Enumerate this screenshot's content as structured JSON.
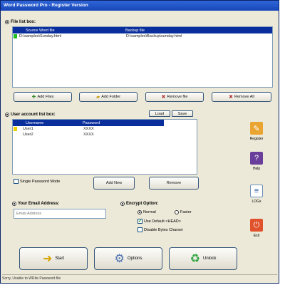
{
  "window": {
    "title": "Word Password Pro - Register Version"
  },
  "file_list": {
    "label": "File list box:",
    "columns": [
      "Source Word file",
      "Backup file"
    ],
    "rows": [
      {
        "source": "D:\\samples\\Sunday.html",
        "backup": "D:\\samples\\Backup\\sunday.html",
        "mark_color": "#1fbf1f"
      }
    ],
    "buttons": {
      "add_files": "Add Files",
      "add_folder": "Add Folder",
      "remove_file": "Remove file",
      "remove_all": "Remove All"
    }
  },
  "user_list": {
    "label": "User account list box:",
    "load_label": "Load",
    "save_label": "Save",
    "columns": [
      "Username",
      "Password"
    ],
    "rows": [
      {
        "username": "User1",
        "password": "XXXX",
        "mark_color": "#f0d000"
      },
      {
        "username": "User2",
        "password": "XXXX",
        "mark_color": ""
      }
    ],
    "single_password_mode": "Single Password Mode",
    "add_new": "Add New",
    "remove": "Remove"
  },
  "email": {
    "label": "Your Email Address:",
    "placeholder": "Email Address"
  },
  "encrypt": {
    "label": "Encrypt Option:",
    "normal": "Normal",
    "faster": "Faster",
    "use_default": "Use Default <HEAD>",
    "disable_charset": "Disable Bytes Charset"
  },
  "side": {
    "register": "Register",
    "help": "Help",
    "logs": "LOGs",
    "exit": "Exit"
  },
  "actions": {
    "start": "Start",
    "options": "Options",
    "unlock": "Unlock"
  },
  "status": "Sorry, Unable to WRIte Password file",
  "colors": {
    "accent": "#0a2e9c",
    "title_bar": "#1847b8"
  }
}
